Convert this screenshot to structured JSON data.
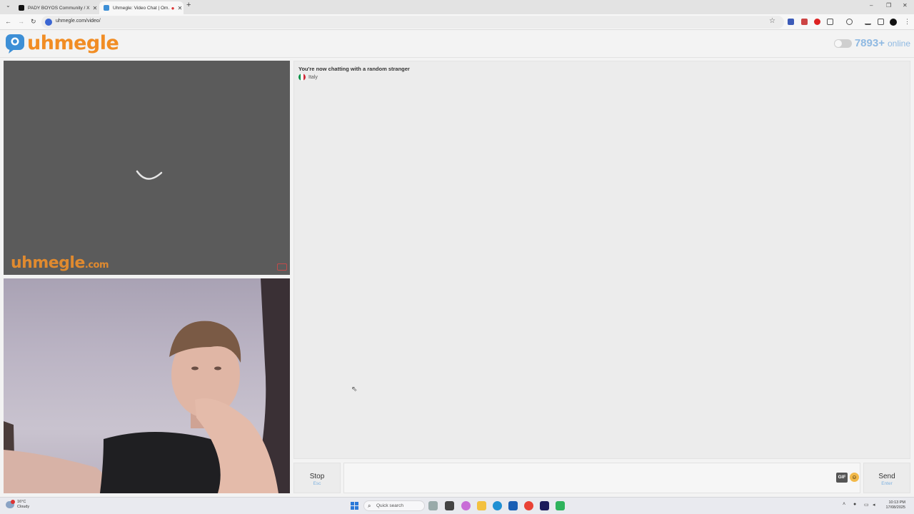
{
  "browser": {
    "tabs": [
      {
        "title": "PADY BOYOS Community / X",
        "active": false,
        "favicon": "x-logo-icon"
      },
      {
        "title": "Uhmegle: Video Chat | Om...",
        "active": true,
        "favicon": "uhmegle-icon"
      }
    ],
    "url": "uhmegle.com/video/"
  },
  "site": {
    "logo_text": "uhmegle",
    "online_count": "7893+",
    "online_label": "online"
  },
  "video": {
    "watermark_main": "uhmegle",
    "watermark_suffix": ".com"
  },
  "chat": {
    "status": "You're now chatting with a random stranger",
    "country": "Italy",
    "flag_colors": [
      "#009246",
      "#ffffff",
      "#ce2b37"
    ]
  },
  "controls": {
    "stop_label": "Stop",
    "stop_hint": "Esc",
    "gif_label": "GIF",
    "send_label": "Send",
    "send_hint": "Enter",
    "message_placeholder": ""
  },
  "taskbar": {
    "weather_temp": "16°C",
    "weather_desc": "Cloudy",
    "search_placeholder": "Quick search",
    "time": "10:13 PM",
    "date": "17/08/2025"
  },
  "colors": {
    "brand_orange": "#f18d24",
    "brand_blue": "#3d8fd6",
    "online_blue": "#8fb9e2"
  }
}
